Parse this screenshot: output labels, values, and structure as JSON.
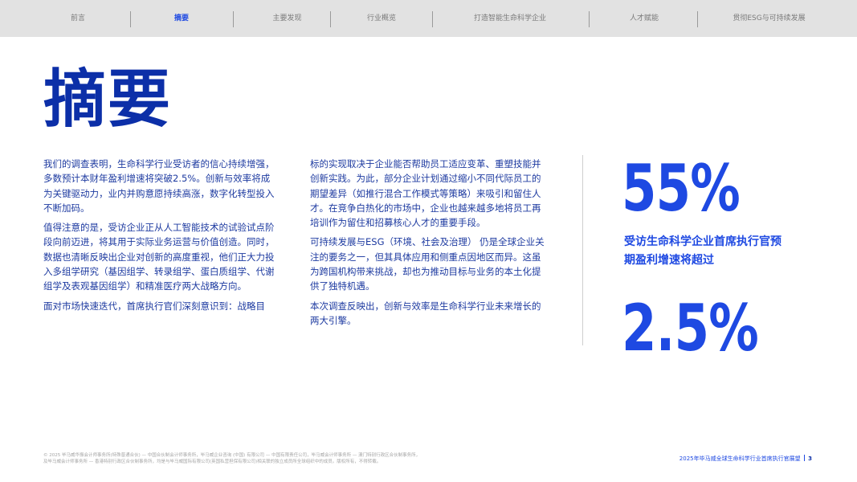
{
  "nav": {
    "items": [
      {
        "label": "前言"
      },
      {
        "label": "摘要",
        "active": true
      },
      {
        "label": "主要发现"
      },
      {
        "label": "行业概览"
      },
      {
        "label": "打造智能生命科学企业"
      },
      {
        "label": "人才赋能"
      },
      {
        "label": "贯彻ESG与可持续发展"
      }
    ]
  },
  "title": "摘要",
  "column1": [
    "我们的调查表明，生命科学行业受访者的信心持续增强，多数预计本财年盈利增速将突破2.5%。创新与效率将成为关键驱动力，业内并购意愿持续高涨，数字化转型投入不断加码。",
    "值得注意的是，受访企业正从人工智能技术的试验试点阶段向前迈进，将其用于实际业务运营与价值创造。同时，数据也清晰反映出企业对创新的高度重视，他们正大力投入多组学研究（基因组学、转录组学、蛋白质组学、代谢组学及表观基因组学）和精准医疗两大战略方向。",
    "面对市场快速迭代，首席执行官们深刻意识到：战略目"
  ],
  "column2": [
    "标的实现取决于企业能否帮助员工适应变革、重塑技能并创新实践。为此，部分企业计划通过缩小不同代际员工的期望差异（如推行混合工作模式等策略）来吸引和留住人才。在竞争白热化的市场中，企业也越来越多地将员工再培训作为留住和招募核心人才的重要手段。",
    "可持续发展与ESG（环境、社会及治理） 仍是全球企业关注的要务之一，但其具体应用和侧重点因地区而异。这虽为跨国机构带来挑战，却也为推动目标与业务的本土化提供了独特机遇。",
    "本次调查反映出，创新与效率是生命科学行业未来增长的两大引擎。"
  ],
  "stats": {
    "value_top": "55%",
    "caption": "受访生命科学企业首席执行官预期盈利增速将超过",
    "value_bottom": "2.5%"
  },
  "footer": {
    "legal_line1": "© 2025 毕马威华振会计师事务所(特殊普通合伙) — 中国合伙制会计师事务所，毕马威企业咨询 (中国) 有限公司 — 中国有限责任公司，毕马威会计师事务所 — 澳门特别行政区合伙制事务所，",
    "legal_line2": "及毕马威会计师事务所 — 香港特别行政区合伙制事务所，均是与毕马威国际有限公司(英国私营担保有限公司)相关联的独立成员所全球组织中的成员。版权所有，不得转载。",
    "report_title": "2025年毕马威全球生命科学行业首席执行官展望",
    "page_number": "3"
  },
  "colors": {
    "accent": "#1e49e2",
    "title": "#0c2fa8",
    "body_text": "#1d3aa0",
    "nav_bg": "#e2e2e2"
  }
}
